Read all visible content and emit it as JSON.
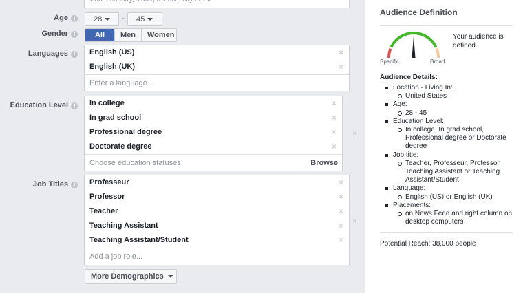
{
  "location": {
    "placeholder": "Add a country, state/province, city or ZIP"
  },
  "age": {
    "label": "Age",
    "min": "28",
    "separator": "-",
    "max": "45"
  },
  "gender": {
    "label": "Gender",
    "options": [
      "All",
      "Men",
      "Women"
    ],
    "selected": "All"
  },
  "languages": {
    "label": "Languages",
    "items": [
      "English (US)",
      "English (UK)"
    ],
    "placeholder": "Enter a language..."
  },
  "education": {
    "label": "Education Level",
    "items": [
      "In college",
      "In grad school",
      "Professional degree",
      "Doctorate degree"
    ],
    "placeholder": "Choose education statuses",
    "browse_label": "Browse"
  },
  "job_titles": {
    "label": "Job Titles",
    "items": [
      "Professeur",
      "Professor",
      "Teacher",
      "Teaching Assistant",
      "Teaching Assistant/Student"
    ],
    "placeholder": "Add a job role..."
  },
  "more_demographics": {
    "label": "More Demographics"
  },
  "remove_glyph": "×",
  "audience": {
    "title": "Audience Definition",
    "status_text": "Your audience is defined.",
    "gauge_min_label": "Specific",
    "gauge_max_label": "Broad",
    "gauge_level": 0.5,
    "colors": {
      "specific": "#d9534f",
      "good": "#42b72a",
      "broad": "#f5c99a",
      "needle": "#1d2129"
    },
    "details_title": "Audience Details:",
    "details": [
      {
        "label": "Location - Living In:",
        "values": [
          "United States"
        ]
      },
      {
        "label": "Age:",
        "values": [
          "28 - 45"
        ]
      },
      {
        "label": "Education Level:",
        "values": [
          "In college, In grad school, Professional degree or Doctorate degree"
        ]
      },
      {
        "label": "Job title:",
        "values": [
          "Teacher, Professeur, Professor, Teaching Assistant or Teaching Assistant/Student"
        ]
      },
      {
        "label": "Language:",
        "values": [
          "English (US) or English (UK)"
        ]
      },
      {
        "label": "Placements:",
        "values": [
          "on News Feed and right column on desktop computers"
        ]
      }
    ],
    "potential_reach": "Potential Reach: 38,000 people"
  }
}
